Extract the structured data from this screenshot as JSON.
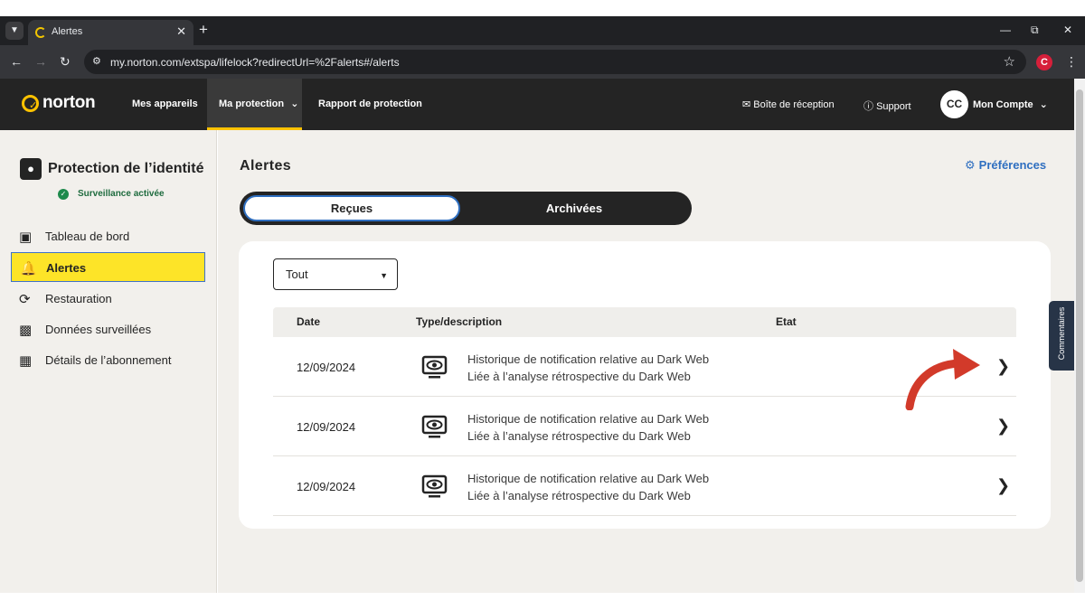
{
  "browser": {
    "tab_title": "Alertes",
    "url": "my.norton.com/extspa/lifelock?redirectUrl=%2Falerts#/alerts",
    "extension_label": "C"
  },
  "header": {
    "logo_text": "norton",
    "nav": [
      "Mes appareils",
      "Ma protection",
      "Rapport de protection"
    ],
    "inbox": "Boîte de réception",
    "support": "Support",
    "avatar": "CC",
    "account": "Mon Compte"
  },
  "sidebar": {
    "title": "Protection de l’identité",
    "status": "Surveillance activée",
    "items": [
      {
        "label": "Tableau de bord",
        "icon": "dashboard-icon"
      },
      {
        "label": "Alertes",
        "icon": "bell-icon"
      },
      {
        "label": "Restauration",
        "icon": "restore-icon"
      },
      {
        "label": "Données surveillées",
        "icon": "monitor-icon"
      },
      {
        "label": "Détails de l’abonnement",
        "icon": "subscription-icon"
      }
    ]
  },
  "main": {
    "title": "Alertes",
    "preferences": "Préférences",
    "tabs": [
      "Reçues",
      "Archivées"
    ],
    "filter_value": "Tout",
    "columns": [
      "Date",
      "Type/description",
      "Etat"
    ],
    "rows": [
      {
        "date": "12/09/2024",
        "line1": "Historique de notification relative au Dark Web",
        "line2": "Liée à l’analyse rétrospective du Dark Web"
      },
      {
        "date": "12/09/2024",
        "line1": "Historique de notification relative au Dark Web",
        "line2": "Liée à l’analyse rétrospective du Dark Web"
      },
      {
        "date": "12/09/2024",
        "line1": "Historique de notification relative au Dark Web",
        "line2": "Liée à l’analyse rétrospective du Dark Web"
      }
    ]
  },
  "feedback": "Commentaires",
  "colors": {
    "brand_yellow": "#fec200",
    "header_bg": "#242424",
    "accent_blue": "#2f6fc0",
    "highlight": "#fde428",
    "annotation_arrow": "#d23a2a"
  }
}
